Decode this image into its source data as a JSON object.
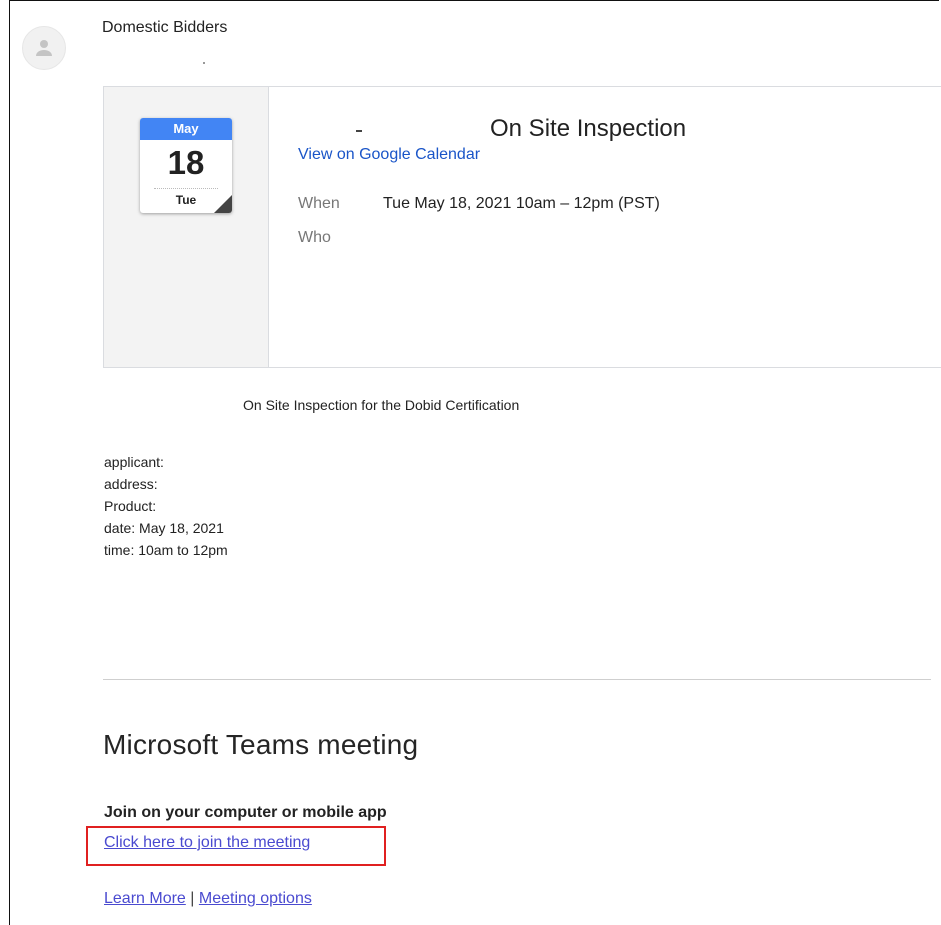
{
  "sender": {
    "name": "Domestic Bidders"
  },
  "calendar_icon": {
    "month": "May",
    "day": "18",
    "weekday": "Tue"
  },
  "event": {
    "title": "On Site Inspection",
    "view_link": "View on Google Calendar",
    "when_label": "When",
    "when_value": "Tue May 18, 2021 10am – 12pm (PST)",
    "who_label": "Who"
  },
  "body": {
    "description": "On Site Inspection for the Dobid Certification",
    "details": [
      "applicant:",
      "address:",
      "Product:",
      "date: May 18, 2021",
      "time: 10am to 12pm"
    ]
  },
  "teams": {
    "title": "Microsoft Teams meeting",
    "join_heading": "Join on your computer or mobile app",
    "join_link": "Click here to join the meeting",
    "learn_more": "Learn More",
    "separator": "|",
    "meeting_options": "Meeting options"
  },
  "colors": {
    "calendar_header": "#4285f4",
    "link": "#1a55c8",
    "teams_link": "#4a4ad0",
    "highlight_box": "#e02020"
  }
}
